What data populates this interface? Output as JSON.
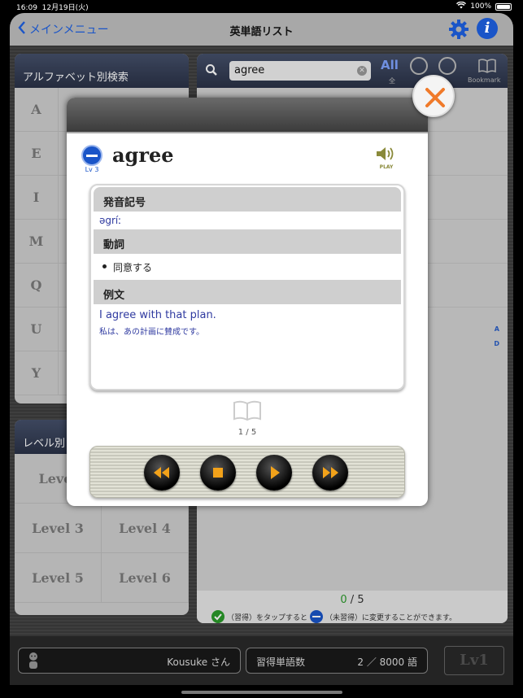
{
  "status": {
    "time": "16:09",
    "date": "12月19日(火)",
    "battery": "100%"
  },
  "nav": {
    "back_label": "メインメニュー",
    "title": "英単語リスト"
  },
  "alphabet": {
    "title": "アルファベット別検索",
    "letters": [
      "A",
      "E",
      "I",
      "M",
      "Q",
      "U",
      "Y"
    ]
  },
  "levels": {
    "title": "レベル別",
    "items": [
      "Level",
      "Level 3",
      "Level 4",
      "Level 5",
      "Level 6"
    ]
  },
  "list": {
    "search_value": "agree",
    "filter_all": "All",
    "filter_all_sub": "全",
    "bookmark_label": "Bookmark",
    "side_letters": [
      "A",
      "D"
    ],
    "count_done": "0",
    "count_sep": "/",
    "count_total": "5",
    "hint_a": "（習得）をタップすると",
    "hint_b": "（未習得）に変更することができます。"
  },
  "bottom": {
    "user_name": "Kousuke さん",
    "learned_label": "習得単語数",
    "learned_value": "2 ／ 8000 語",
    "lv_label": "Lv1"
  },
  "modal": {
    "level_label": "Lv 3",
    "word": "agree",
    "play_label": "PLAY",
    "sections": {
      "pron_head": "発音記号",
      "pron": "əgríː",
      "pos_head": "動詞",
      "meaning": "同意する",
      "example_head": "例文",
      "example_en": "I agree with that plan.",
      "example_ja": "私は、あの計画に賛成です。"
    },
    "page": "1 / 5"
  },
  "colors": {
    "accent": "#1a55c8",
    "close": "#f07a2a",
    "learned": "#2a9a2a"
  }
}
